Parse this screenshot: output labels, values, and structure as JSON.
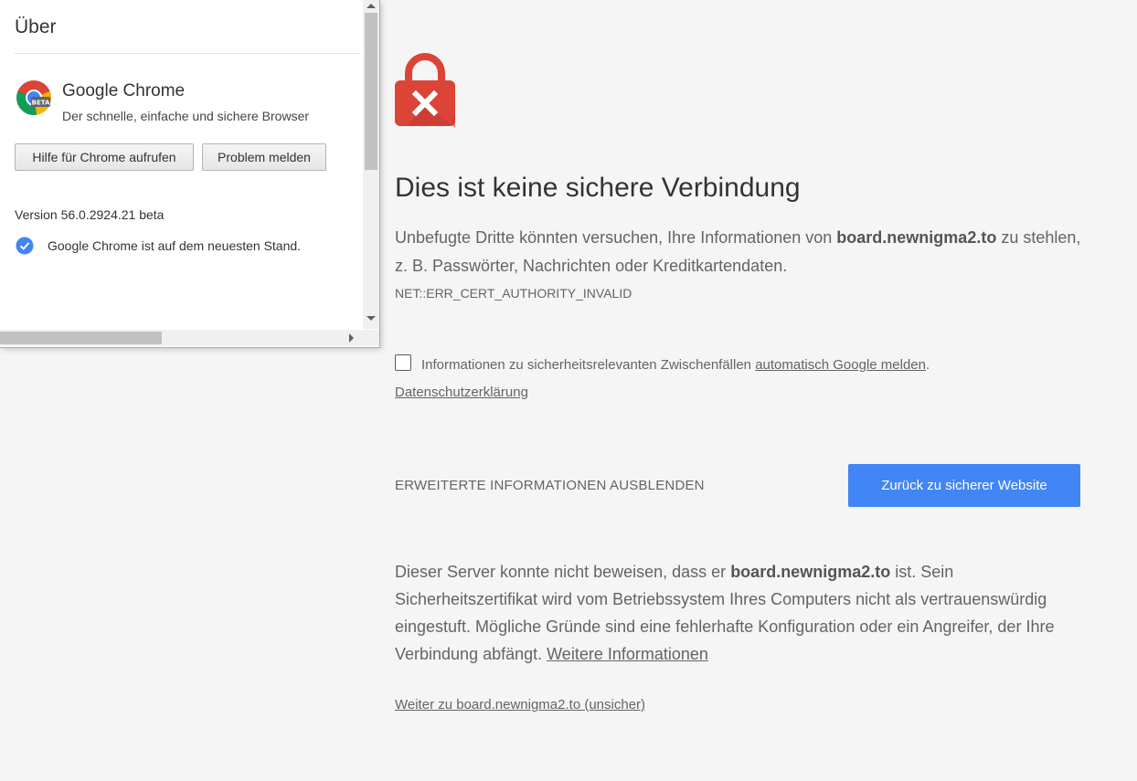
{
  "about": {
    "title": "Über",
    "product_name": "Google Chrome",
    "product_tagline": "Der schnelle, einfache und sichere Browser",
    "logo_badge": "BETA",
    "help_button": "Hilfe für Chrome aufrufen",
    "report_button": "Problem melden",
    "version": "Version 56.0.2924.21 beta",
    "update_status": "Google Chrome ist auf dem neuesten Stand.",
    "colors": {
      "check_icon": "#4285f4"
    }
  },
  "interstitial": {
    "heading": "Dies ist keine sichere Verbindung",
    "explanation_pre": "Unbefugte Dritte könnten versuchen, Ihre Informationen von ",
    "explanation_host": "board.newnigma2.to",
    "explanation_post": " zu stehlen, z. B. Passwörter, Nachrichten oder Kreditkartendaten.",
    "error_code": "NET::ERR_CERT_AUTHORITY_INVALID",
    "report_pre": "Informationen zu sicherheitsrelevanten Zwischenfällen ",
    "report_link": "automatisch Google melden",
    "report_post": ".",
    "report_checked": false,
    "privacy_link": "Datenschutzerklärung",
    "advanced_toggle": "ERWEITERTE INFORMATIONEN AUSBLENDEN",
    "back_button": "Zurück zu sicherer Website",
    "details_pre": "Dieser Server konnte nicht beweisen, dass er ",
    "details_host": "board.newnigma2.to",
    "details_post": " ist. Sein Sicherheitszertifikat wird vom Betriebssystem Ihres Computers nicht als vertrauenswürdig eingestuft. Mögliche Gründe sind eine fehlerhafte Konfiguration oder ein Angreifer, der Ihre Verbindung abfängt. ",
    "details_link": "Weitere Informationen",
    "proceed_link": "Weiter zu board.newnigma2.to (unsicher)",
    "colors": {
      "lock": "#db4437",
      "button": "#4285f4",
      "background": "#f5f5f5"
    }
  }
}
